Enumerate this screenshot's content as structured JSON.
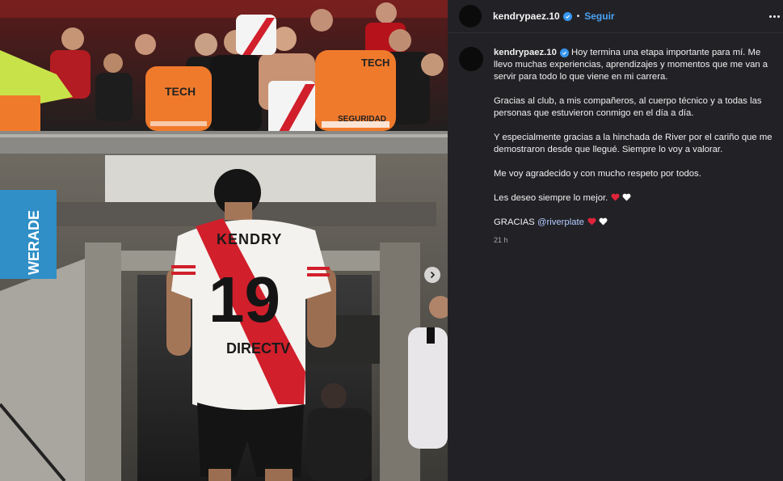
{
  "post": {
    "username": "kendrypaez.10",
    "dot": "•",
    "follow_label": "Seguir",
    "timestamp": "21 h"
  },
  "caption": {
    "username": "kendrypaez.10",
    "p1": "Hoy termina una etapa importante para mí. Me llevo muchas experiencias, aprendizajes y momentos que me van a servir para todo lo que viene en mi carrera.",
    "p2": "Gracias al club, a mis compañeros, al cuerpo técnico y a todas las personas que estuvieron conmigo en el día a día.",
    "p3": "Y especialmente gracias a la hinchada de River por el cariño que me demostraron desde que llegué. Siempre lo voy a valorar.",
    "p4": "Me voy agradecido y con mucho respeto por todos.",
    "p5": "Les deseo siempre lo mejor.",
    "p6_text": "GRACIAS",
    "p6_mention": "@riverplate"
  },
  "photo": {
    "jersey_name": "KENDRY",
    "jersey_number": "19",
    "sponsor": "DIRECTV",
    "vest_text": "TECH",
    "vest_text_2": "SEGURIDAD",
    "side_banner": "WERADE"
  },
  "icons": {
    "verified": "verified-badge-icon",
    "more": "more-options-icon",
    "next": "chevron-right-icon",
    "red_heart": "red-heart-icon",
    "white_heart": "white-heart-icon"
  },
  "colors": {
    "panel_bg": "#222226",
    "accent_blue": "#4aa3f5",
    "verified_blue": "#3897f0",
    "river_red": "#d11f2b",
    "vest_orange": "#f07a2c"
  }
}
